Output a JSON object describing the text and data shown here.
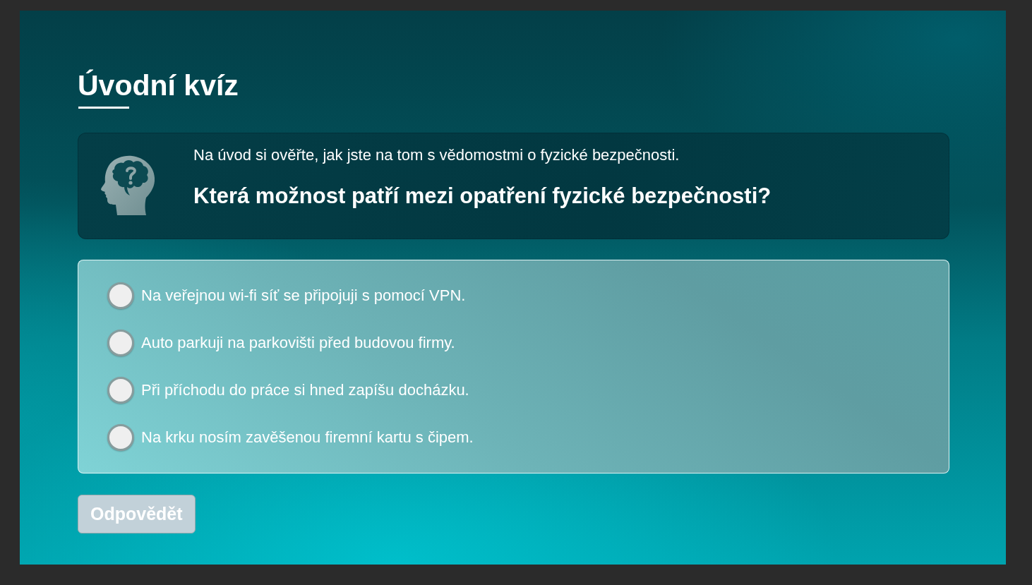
{
  "quiz": {
    "title": "Úvodní kvíz"
  },
  "prompt": {
    "intro": "Na úvod si ověřte, jak jste na tom s vědomostmi o fyzické bezpečnosti.",
    "question": "Která možnost patří mezi opatření fyzické bezpečnosti?"
  },
  "options": [
    {
      "label": "Na veřejnou wi-fi síť se připojuji s pomocí VPN.",
      "selected": false
    },
    {
      "label": "Auto parkuji na parkovišti před budovou firmy.",
      "selected": false
    },
    {
      "label": "Při příchodu do práce si hned zapíšu docházku.",
      "selected": false
    },
    {
      "label": "Na krku nosím zavěšenou firemní kartu s čipem.",
      "selected": false
    }
  ],
  "submit": {
    "label": "Odpovědět",
    "disabled": true
  }
}
